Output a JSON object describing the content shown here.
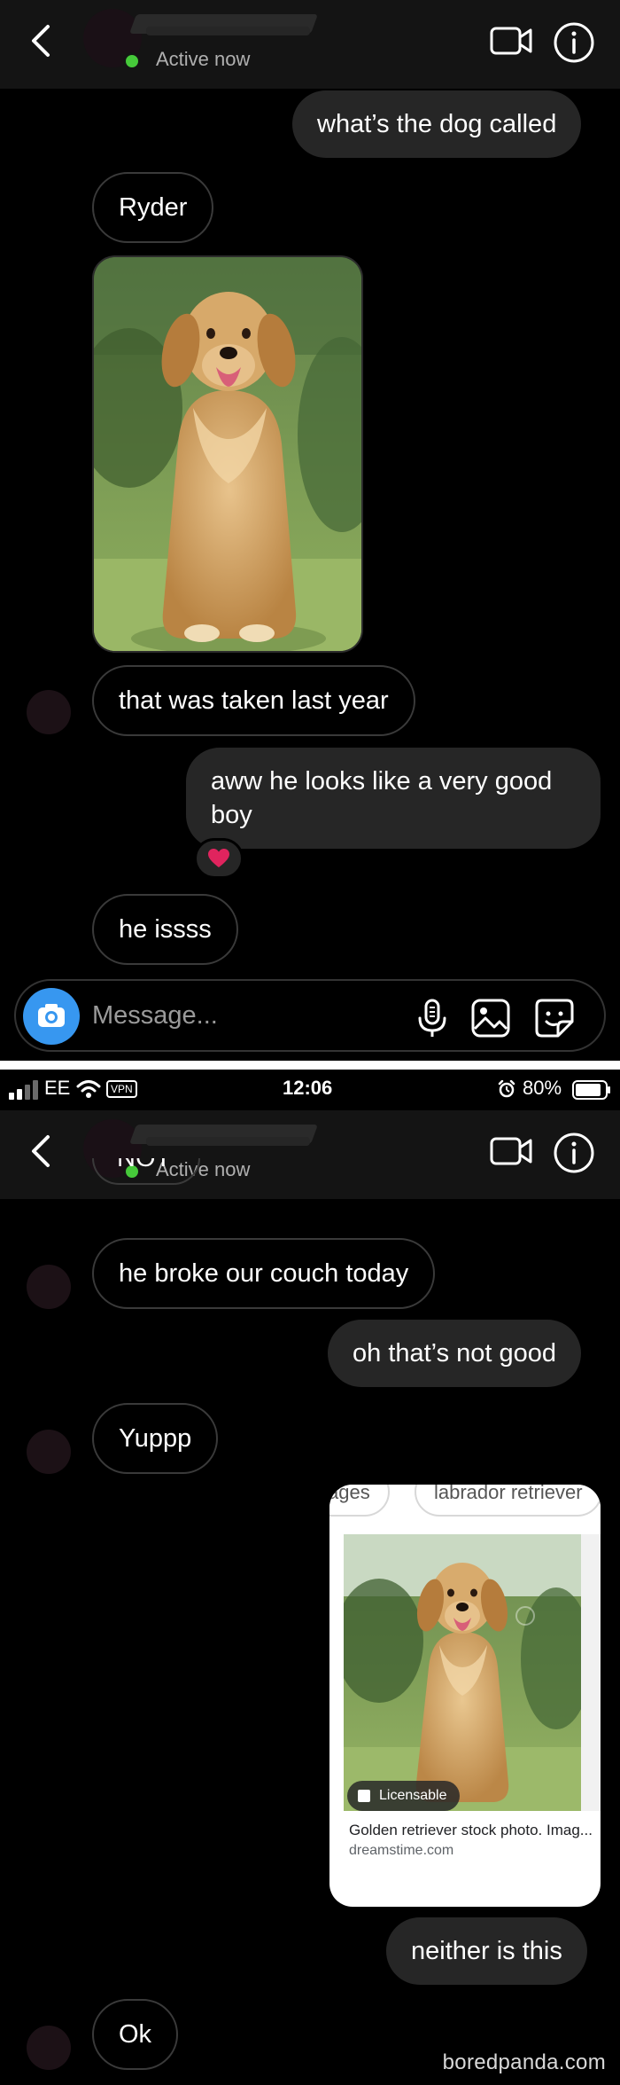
{
  "screen1": {
    "header": {
      "status": "Active now"
    },
    "messages": [
      {
        "dir": "sent",
        "text": "what’s the dog called"
      },
      {
        "dir": "recv",
        "text": "Ryder"
      },
      {
        "dir": "recv",
        "text": "that was taken last year"
      },
      {
        "dir": "sent",
        "text": "aww he looks like a very good boy",
        "reaction": "❤️"
      },
      {
        "dir": "recv",
        "text": "he issss"
      }
    ],
    "composer": {
      "placeholder": "Message..."
    }
  },
  "screen2": {
    "statusbar": {
      "carrier": "EE",
      "vpn": "VPN",
      "time": "12:06",
      "battery": "80%"
    },
    "header": {
      "status": "Active now"
    },
    "messages": [
      {
        "dir": "recv",
        "text": "NOT"
      },
      {
        "dir": "recv",
        "text": "he broke our couch today"
      },
      {
        "dir": "sent",
        "text": "oh that’s not good"
      },
      {
        "dir": "recv",
        "text": "Yuppp"
      },
      {
        "dir": "sent",
        "text": "neither is this"
      },
      {
        "dir": "recv",
        "text": "Ok"
      }
    ],
    "shared_card": {
      "chips": [
        "ages",
        "labrador retriever"
      ],
      "badge": "Licensable",
      "title": "Golden retriever stock photo. Imag...",
      "source": "dreamstime.com"
    }
  },
  "watermark": "boredpanda.com",
  "colors": {
    "background": "#000000",
    "header": "#141414",
    "sent_bubble": "#262626",
    "online": "#46c93a",
    "camera_button": "#3797f0",
    "reaction_heart": "#e0245e"
  },
  "icons": [
    "back-icon",
    "video-call-icon",
    "info-icon",
    "camera-icon",
    "microphone-icon",
    "gallery-icon",
    "sticker-icon",
    "heart-icon",
    "wifi-icon",
    "signal-icon",
    "alarm-icon",
    "battery-icon"
  ]
}
